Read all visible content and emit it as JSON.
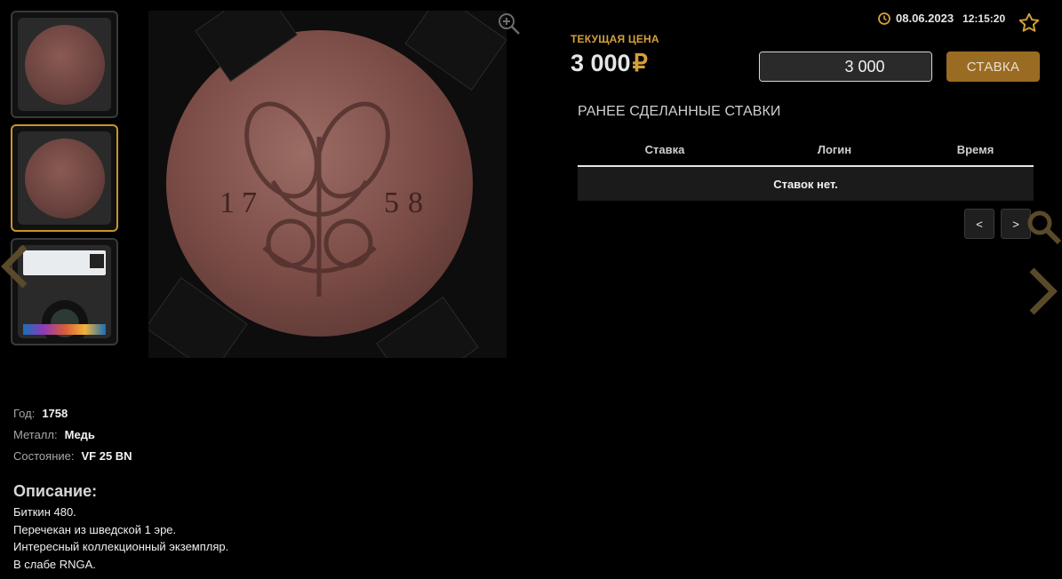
{
  "thumbnails": [
    {
      "name": "thumb-coin-reverse",
      "active": false
    },
    {
      "name": "thumb-coin-obverse",
      "active": true
    },
    {
      "name": "thumb-slab",
      "active": false
    }
  ],
  "icons": {
    "zoom": "zoom-in-icon",
    "clock": "clock-icon",
    "star": "star-icon",
    "prev": "chevron-left-icon",
    "next": "chevron-right-icon",
    "search": "search-icon"
  },
  "colors": {
    "accent": "#d4a03a",
    "button": "#9a6b22"
  },
  "auction": {
    "date": "08.06.2023",
    "time": "12:15:20",
    "price_label": "ТЕКУЩАЯ ЦЕНА",
    "price_value": "3 000",
    "currency_symbol": "₽",
    "bid_input_value": "3 000",
    "bid_currency": "₽",
    "bid_button": "СТАВКА"
  },
  "bids": {
    "title": "РАНЕЕ СДЕЛАННЫЕ СТАВКИ",
    "columns": [
      "Ставка",
      "Логин",
      "Время"
    ],
    "empty_text": "Ставок нет.",
    "prev_label": "<",
    "next_label": ">"
  },
  "specs": [
    {
      "label": "Год:",
      "value": "1758"
    },
    {
      "label": "Металл:",
      "value": "Медь"
    },
    {
      "label": "Состояние:",
      "value": "VF 25 BN"
    }
  ],
  "description": {
    "title": "Описание:",
    "lines": [
      "Биткин 480.",
      "Перечекан из шведской 1 эре.",
      "Интересный коллекционный экземпляр.",
      "В слабе RNGA."
    ]
  }
}
